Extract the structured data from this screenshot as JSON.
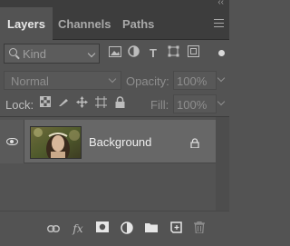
{
  "tabs": [
    {
      "label": "Layers",
      "active": true
    },
    {
      "label": "Channels",
      "active": false
    },
    {
      "label": "Paths",
      "active": false
    }
  ],
  "filter": {
    "kind_label": "Kind",
    "icons": [
      "image-filter-icon",
      "adjustment-filter-icon",
      "type-filter-icon",
      "shape-filter-icon",
      "smart-object-filter-icon"
    ],
    "toggle_state": "on"
  },
  "blend": {
    "mode": "Normal",
    "opacity_label": "Opacity:",
    "opacity_value": "100%"
  },
  "lock": {
    "label": "Lock:",
    "icons": [
      "lock-transparent-pixels-icon",
      "lock-image-pixels-icon",
      "lock-position-icon",
      "lock-artboard-icon",
      "lock-all-icon"
    ],
    "fill_label": "Fill:",
    "fill_value": "100%"
  },
  "layers": [
    {
      "name": "Background",
      "visible": true,
      "locked": true
    }
  ],
  "footer_icons": [
    "link-layers-icon",
    "fx-icon",
    "layer-mask-icon",
    "adjustment-layer-icon",
    "group-folder-icon",
    "new-layer-icon",
    "trash-icon"
  ],
  "colors": {
    "panel_bg": "#535353",
    "tabbar_bg": "#3d3d3d",
    "selected_row": "#676767"
  }
}
